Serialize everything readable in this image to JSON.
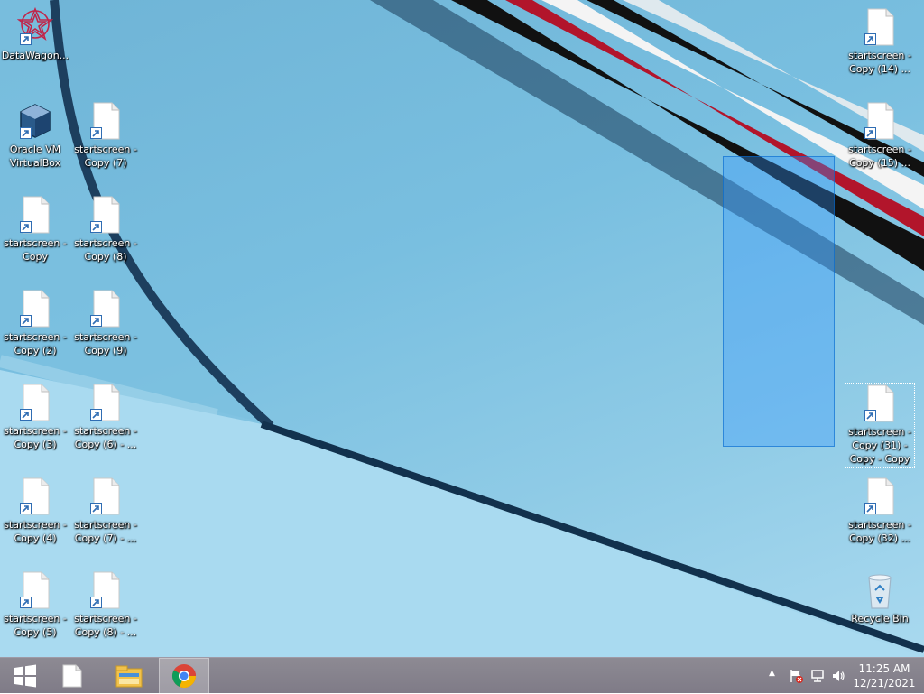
{
  "desktop": {
    "icons": [
      {
        "label": "DataWagon...",
        "type": "datawagon"
      },
      {
        "label": "Oracle VM\nVirtualBox",
        "type": "virtualbox"
      },
      {
        "label": "startscreen -\nCopy (7)",
        "type": "file"
      },
      {
        "label": "startscreen -\nCopy",
        "type": "file"
      },
      {
        "label": "startscreen -\nCopy (8)",
        "type": "file"
      },
      {
        "label": "startscreen -\nCopy (2)",
        "type": "file"
      },
      {
        "label": "startscreen -\nCopy (9)",
        "type": "file"
      },
      {
        "label": "startscreen -\nCopy (3)",
        "type": "file"
      },
      {
        "label": "startscreen -\nCopy (6) - ...",
        "type": "file"
      },
      {
        "label": "startscreen -\nCopy (4)",
        "type": "file"
      },
      {
        "label": "startscreen -\nCopy (7) - ...",
        "type": "file"
      },
      {
        "label": "startscreen -\nCopy (5)",
        "type": "file"
      },
      {
        "label": "startscreen -\nCopy (8) - ...",
        "type": "file"
      },
      {
        "label": "startscreen -\nCopy (14) ...",
        "type": "file"
      },
      {
        "label": "startscreen -\nCopy (15) ...",
        "type": "file"
      },
      {
        "label": "startscreen -\nCopy (31) -\nCopy - Copy",
        "type": "file",
        "selected": true
      },
      {
        "label": "startscreen -\nCopy (32) ...",
        "type": "file"
      },
      {
        "label": "Recycle Bin",
        "type": "recycle-bin"
      }
    ]
  },
  "taskbar": {
    "start_icon": "windows-start-icon",
    "pinned": [
      "file-icon",
      "file-explorer-icon",
      "chrome-icon"
    ],
    "active": "chrome-icon",
    "tray_icons": [
      "show-hidden-icons",
      "action-center-flag-icon",
      "network-icon",
      "volume-icon"
    ],
    "time": "11:25 AM",
    "date": "12/21/2021"
  },
  "colors": {
    "accent": "#3399ff",
    "taskbar": "#857f8c"
  }
}
